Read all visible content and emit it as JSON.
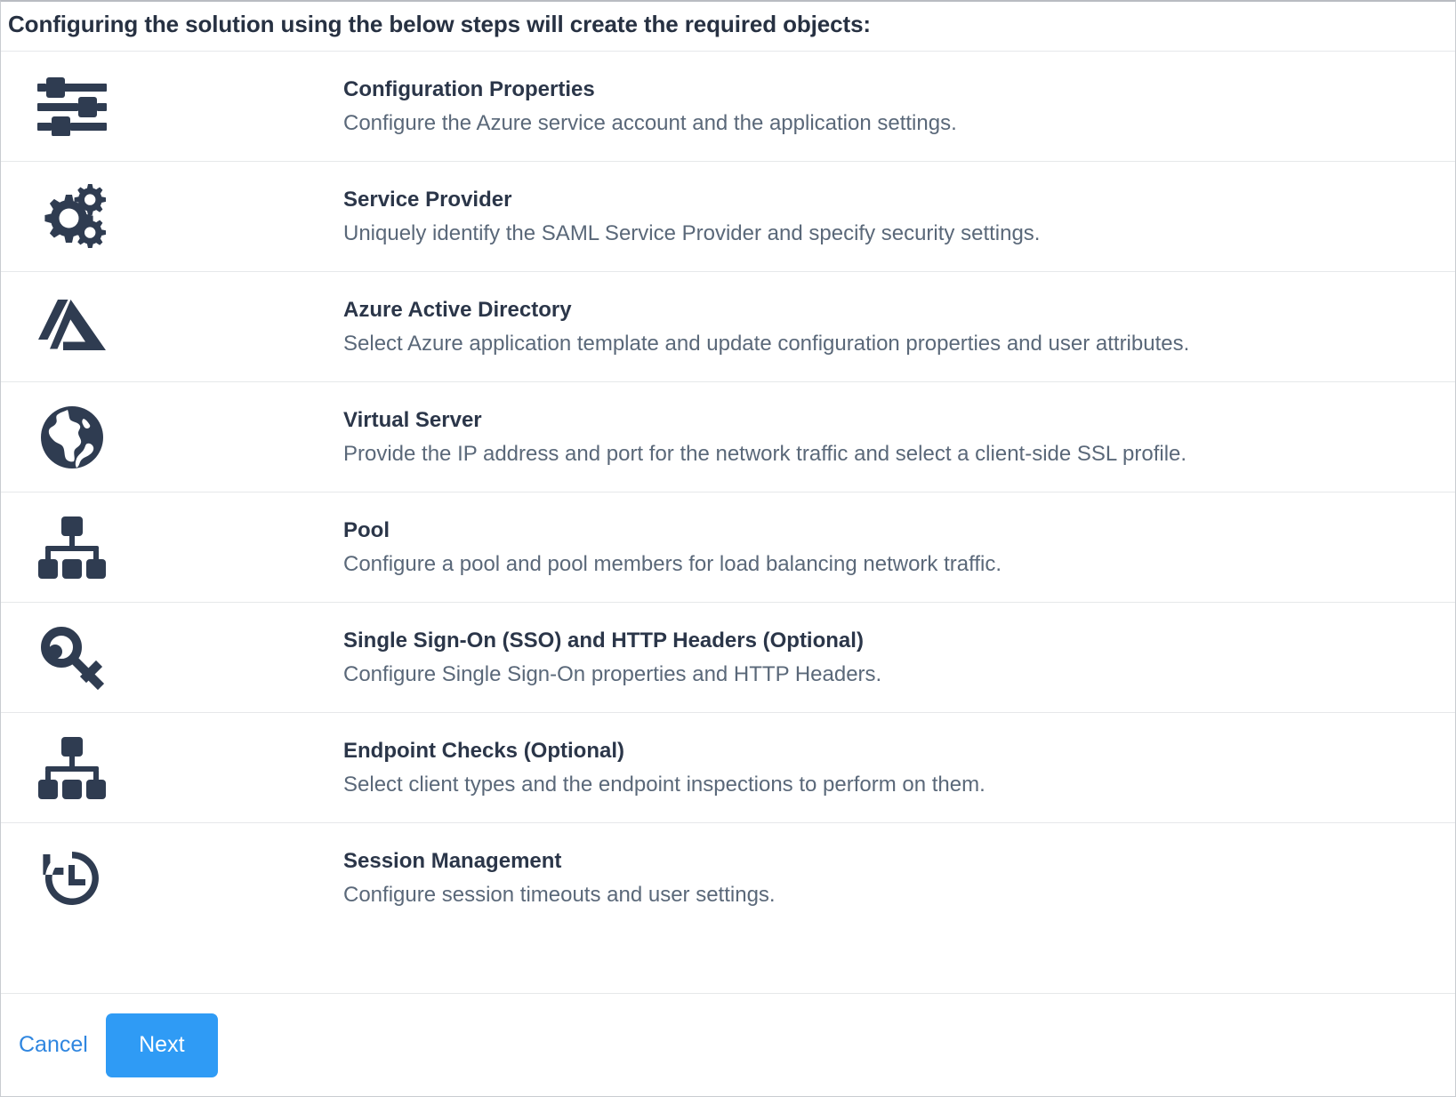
{
  "header": {
    "title": "Configuring the solution using the below steps will create the required objects:"
  },
  "steps": [
    {
      "icon": "sliders-icon",
      "title": "Configuration Properties",
      "description": "Configure the Azure service account and the application settings."
    },
    {
      "icon": "gears-icon",
      "title": "Service Provider",
      "description": "Uniquely identify the SAML Service Provider and specify security settings."
    },
    {
      "icon": "azure-logo-icon",
      "title": "Azure Active Directory",
      "description": "Select Azure application template and update configuration properties and user attributes."
    },
    {
      "icon": "globe-icon",
      "title": "Virtual Server",
      "description": "Provide the IP address and port for the network traffic and select a client-side SSL profile."
    },
    {
      "icon": "sitemap-icon",
      "title": "Pool",
      "description": "Configure a pool and pool members for load balancing network traffic."
    },
    {
      "icon": "key-icon",
      "title": "Single Sign-On (SSO) and HTTP Headers (Optional)",
      "description": "Configure Single Sign-On properties and HTTP Headers."
    },
    {
      "icon": "sitemap-icon",
      "title": "Endpoint Checks (Optional)",
      "description": "Select client types and the endpoint inspections to perform on them."
    },
    {
      "icon": "history-clock-icon",
      "title": "Session Management",
      "description": "Configure session timeouts and user settings."
    }
  ],
  "footer": {
    "cancel_label": "Cancel",
    "next_label": "Next"
  },
  "colors": {
    "icon": "#2f3c51",
    "title_text": "#2b3649",
    "description_text": "#5a6879",
    "primary_button_bg": "#2f9bf5",
    "link_text": "#2f86e0",
    "divider": "#e6e8ea"
  }
}
